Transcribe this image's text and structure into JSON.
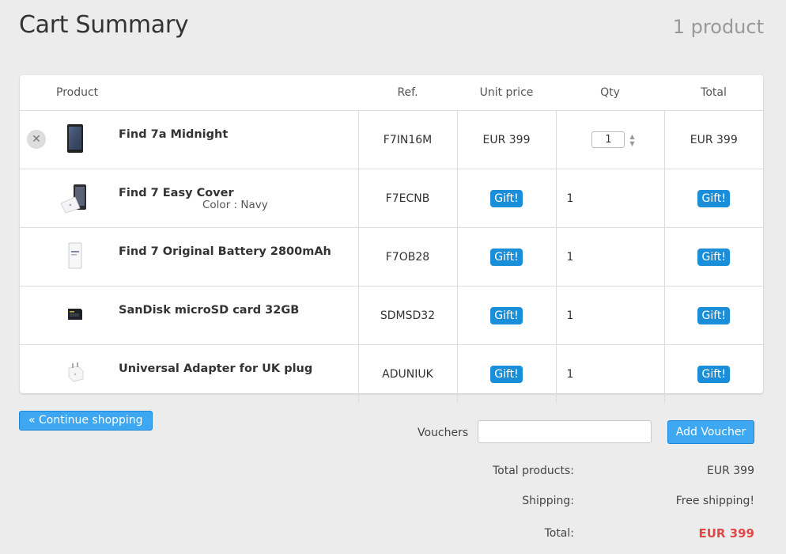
{
  "header": {
    "title": "Cart Summary",
    "count": "1 product"
  },
  "table": {
    "columns": {
      "product": "Product",
      "ref": "Ref.",
      "unit_price": "Unit price",
      "qty": "Qty",
      "total": "Total"
    },
    "rows": [
      {
        "name": "Find 7a Midnight",
        "variant": "",
        "ref": "F7IN16M",
        "unit_price": "EUR 399",
        "qty": "1",
        "total": "EUR 399",
        "thumb_icon": "phone-image"
      },
      {
        "name": "Find 7 Easy Cover",
        "variant": "Color : Navy",
        "ref": "F7ECNB",
        "unit_price": "Gift!",
        "qty": "1",
        "total": "Gift!",
        "thumb_icon": "phone-cover-image"
      },
      {
        "name": "Find 7 Original Battery 2800mAh",
        "variant": "",
        "ref": "F7OB28",
        "unit_price": "Gift!",
        "qty": "1",
        "total": "Gift!",
        "thumb_icon": "battery-image"
      },
      {
        "name": "SanDisk microSD card 32GB",
        "variant": "",
        "ref": "SDMSD32",
        "unit_price": "Gift!",
        "qty": "1",
        "total": "Gift!",
        "thumb_icon": "sd-card-image"
      },
      {
        "name": "Universal Adapter for UK plug",
        "variant": "",
        "ref": "ADUNIUK",
        "unit_price": "Gift!",
        "qty": "1",
        "total": "Gift!",
        "thumb_icon": "plug-adapter-image"
      }
    ]
  },
  "actions": {
    "continue_label": "« Continue shopping",
    "voucher_label": "Vouchers",
    "voucher_value": "",
    "add_voucher_label": "Add Voucher"
  },
  "summary": {
    "total_products_label": "Total products:",
    "total_products_value": "EUR 399",
    "shipping_label": "Shipping:",
    "shipping_value": "Free shipping!",
    "total_label": "Total:",
    "total_value": "EUR 399"
  },
  "colors": {
    "accent": "#3ea7f2",
    "gift_badge": "#1a8ed8",
    "total": "#e04848",
    "background": "#ececec"
  }
}
